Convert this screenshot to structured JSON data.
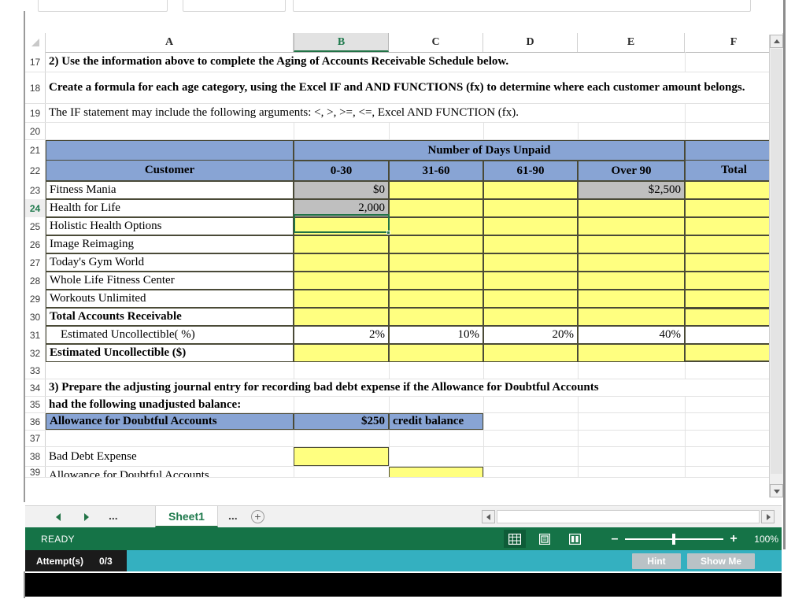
{
  "spreadsheet": {
    "columns": [
      {
        "label": "A",
        "selected": false
      },
      {
        "label": "B",
        "selected": true
      },
      {
        "label": "C",
        "selected": false
      },
      {
        "label": "D",
        "selected": false
      },
      {
        "label": "E",
        "selected": false
      },
      {
        "label": "F",
        "selected": false
      }
    ],
    "active_cell": "B24",
    "rows": [
      {
        "num": "17",
        "cells": {
          "A": "2) Use the information above to complete the Aging of Accounts Receivable Schedule below."
        }
      },
      {
        "num": "18",
        "cells": {
          "A": "Create a formula for each age category, using the Excel IF and AND FUNCTIONS (fx) to determine where each customer amount belongs."
        }
      },
      {
        "num": "19",
        "cells": {
          "A": "The IF statement may include the following arguments:  <, >, >=, <=, Excel AND FUNCTION (fx)."
        }
      },
      {
        "num": "20",
        "cells": {
          "A": ""
        }
      },
      {
        "num": "21",
        "cells": {
          "A": "",
          "B": "Number of Days Unpaid",
          "F": ""
        }
      },
      {
        "num": "22",
        "cells": {
          "A": "Customer",
          "B": "0-30",
          "C": "31-60",
          "D": "61-90",
          "E": "Over 90",
          "F": "Total"
        }
      },
      {
        "num": "23",
        "cells": {
          "A": "Fitness Mania",
          "B": "$0",
          "C": "",
          "D": "",
          "E": "$2,500",
          "F": ""
        }
      },
      {
        "num": "24",
        "cells": {
          "A": "Health for Life",
          "B": "2,000",
          "C": "",
          "D": "",
          "E": "",
          "F": ""
        }
      },
      {
        "num": "25",
        "cells": {
          "A": "Holistic Health Options",
          "B": "",
          "C": "",
          "D": "",
          "E": "",
          "F": ""
        }
      },
      {
        "num": "26",
        "cells": {
          "A": "Image Reimaging",
          "B": "",
          "C": "",
          "D": "",
          "E": "",
          "F": ""
        }
      },
      {
        "num": "27",
        "cells": {
          "A": "Today's Gym World",
          "B": "",
          "C": "",
          "D": "",
          "E": "",
          "F": ""
        }
      },
      {
        "num": "28",
        "cells": {
          "A": "Whole Life Fitness Center",
          "B": "",
          "C": "",
          "D": "",
          "E": "",
          "F": ""
        }
      },
      {
        "num": "29",
        "cells": {
          "A": "Workouts Unlimited",
          "B": "",
          "C": "",
          "D": "",
          "E": "",
          "F": ""
        }
      },
      {
        "num": "30",
        "cells": {
          "A": "Total Accounts Receivable",
          "B": "",
          "C": "",
          "D": "",
          "E": "",
          "F": ""
        }
      },
      {
        "num": "31",
        "cells": {
          "A": "Estimated Uncollectible( %)",
          "B": "2%",
          "C": "10%",
          "D": "20%",
          "E": "40%",
          "F": ""
        }
      },
      {
        "num": "32",
        "cells": {
          "A": "Estimated Uncollectible ($)",
          "B": "",
          "C": "",
          "D": "",
          "E": "",
          "F": ""
        }
      },
      {
        "num": "33",
        "cells": {
          "A": ""
        }
      },
      {
        "num": "34",
        "cells": {
          "A": "3) Prepare the adjusting journal entry for recording bad debt expense if the Allowance for Doubtful Accounts"
        }
      },
      {
        "num": "35",
        "cells": {
          "A": "had the following unadjusted balance:"
        }
      },
      {
        "num": "36",
        "cells": {
          "A": "Allowance for Doubtful Accounts",
          "B": "$250",
          "C": "credit balance"
        }
      },
      {
        "num": "37",
        "cells": {
          "A": ""
        }
      },
      {
        "num": "38",
        "cells": {
          "A": "Bad Debt Expense",
          "B": "",
          "C": ""
        }
      },
      {
        "num": "39",
        "cells": {
          "A": "Allowance for Doubtful Accounts",
          "B": "",
          "C": ""
        }
      }
    ]
  },
  "tabbar": {
    "prev_label": "previous-sheet",
    "next_label": "next-sheet",
    "left_ellipsis": "...",
    "right_ellipsis": "...",
    "sheet_name": "Sheet1",
    "add_sheet_label": "+"
  },
  "status": {
    "mode": "READY",
    "zoom_percent": "100%",
    "zoom_minus": "–",
    "zoom_plus": "+",
    "views": [
      "normal-view-icon",
      "page-layout-icon",
      "page-break-preview-icon"
    ]
  },
  "attempts": {
    "label": "Attempt(s)",
    "count": "0/3",
    "hint_label": "Hint",
    "show_me_label": "Show Me"
  },
  "colors": {
    "header_blue": "#88a4d4",
    "input_yellow": "#ffff80",
    "locked_gray": "#bfbfbf",
    "status_green": "#157347",
    "attempt_teal": "#34b0c0",
    "selection_green": "#217346"
  }
}
